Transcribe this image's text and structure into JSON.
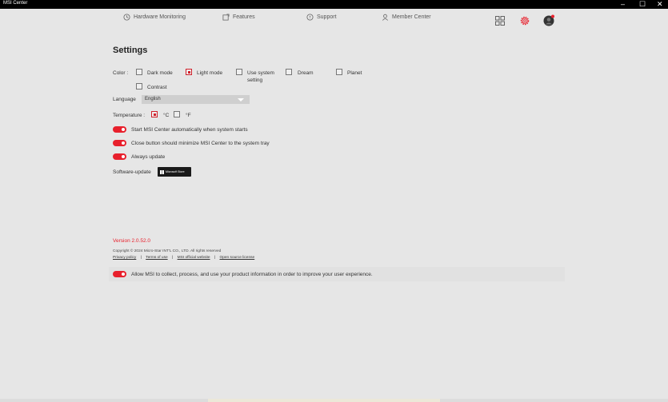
{
  "window": {
    "title": "MSI Center",
    "controls": {
      "minimize": "–",
      "maximize": "☐",
      "close": "✕"
    }
  },
  "nav": {
    "items": [
      {
        "label": "Hardware Monitoring",
        "icon": "hardware-monitoring-icon"
      },
      {
        "label": "Features",
        "icon": "features-icon"
      },
      {
        "label": "Support",
        "icon": "support-icon"
      },
      {
        "label": "Member Center",
        "icon": "member-icon"
      }
    ],
    "right_icons": [
      "grid-icon",
      "gear-icon",
      "avatar"
    ]
  },
  "settings": {
    "title": "Settings",
    "color_label": "Color :",
    "color_options": [
      {
        "label": "Dark mode",
        "checked": false
      },
      {
        "label": "Light mode",
        "checked": true
      },
      {
        "label_line1": "Use system",
        "label_line2": "setting",
        "checked": false
      },
      {
        "label": "Dream",
        "checked": false
      },
      {
        "label": "Planet",
        "checked": false
      },
      {
        "label": "Contrast",
        "checked": false
      }
    ],
    "language_label": "Language",
    "language_value": "English",
    "temperature_label": "Temperature :",
    "temperature_options": [
      {
        "label": "°C",
        "checked": true
      },
      {
        "label": "°F",
        "checked": false
      }
    ],
    "toggles": [
      {
        "label": "Start MSI Center automatically when system starts",
        "on": true
      },
      {
        "label": "Close button should minimize MSI Center to the system tray",
        "on": true
      },
      {
        "label": "Always update",
        "on": true
      }
    ],
    "software_update_label": "Software-update",
    "store_badge_text": "Microsoft Store"
  },
  "footer": {
    "version": "Version 2.0.52.0",
    "copyright": "Copyright © 2024 Micro-Star INT'L CO., LTD. All rights reserved",
    "links": [
      "Privacy policy",
      "Terms of use",
      "MSI official website",
      "Open source license"
    ],
    "link_separator": "|",
    "consent_label": "Allow MSI to collect, process, and use your product information in order to improve your user experience.",
    "consent_on": true
  },
  "colors": {
    "accent": "#e8202c",
    "background": "#e6e6e6",
    "titlebar": "#000000"
  }
}
